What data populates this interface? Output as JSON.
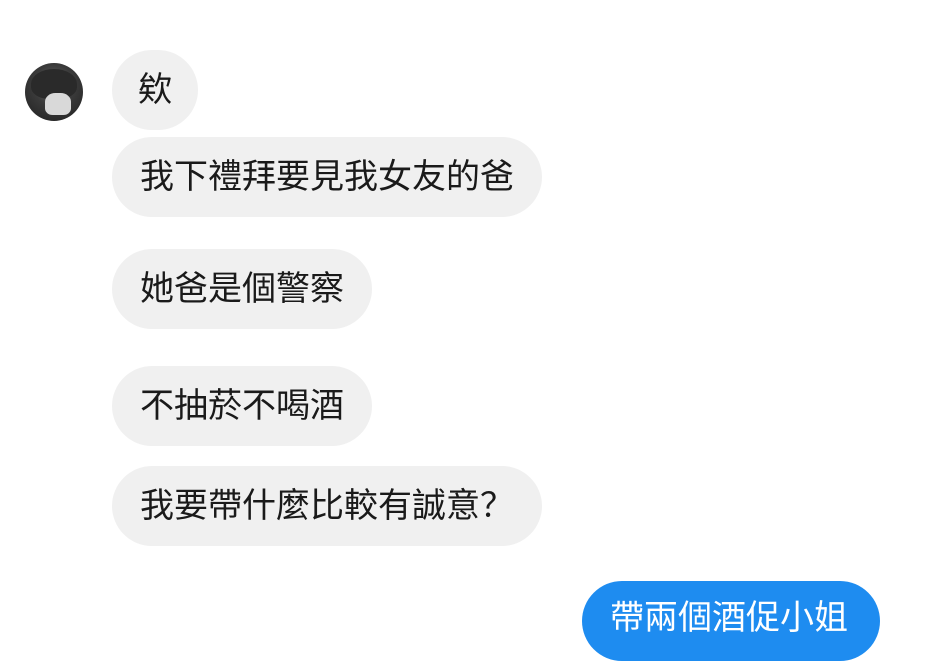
{
  "conversation": {
    "incoming": [
      "欸",
      "我下禮拜要見我女友的爸",
      "她爸是個警察",
      "不抽菸不喝酒",
      "我要帶什麼比較有誠意？"
    ],
    "outgoing": [
      "帶兩個酒促小姐"
    ]
  },
  "colors": {
    "incoming_bubble": "#f0f0f0",
    "outgoing_bubble": "#1e8cf0",
    "background": "#ffffff"
  }
}
